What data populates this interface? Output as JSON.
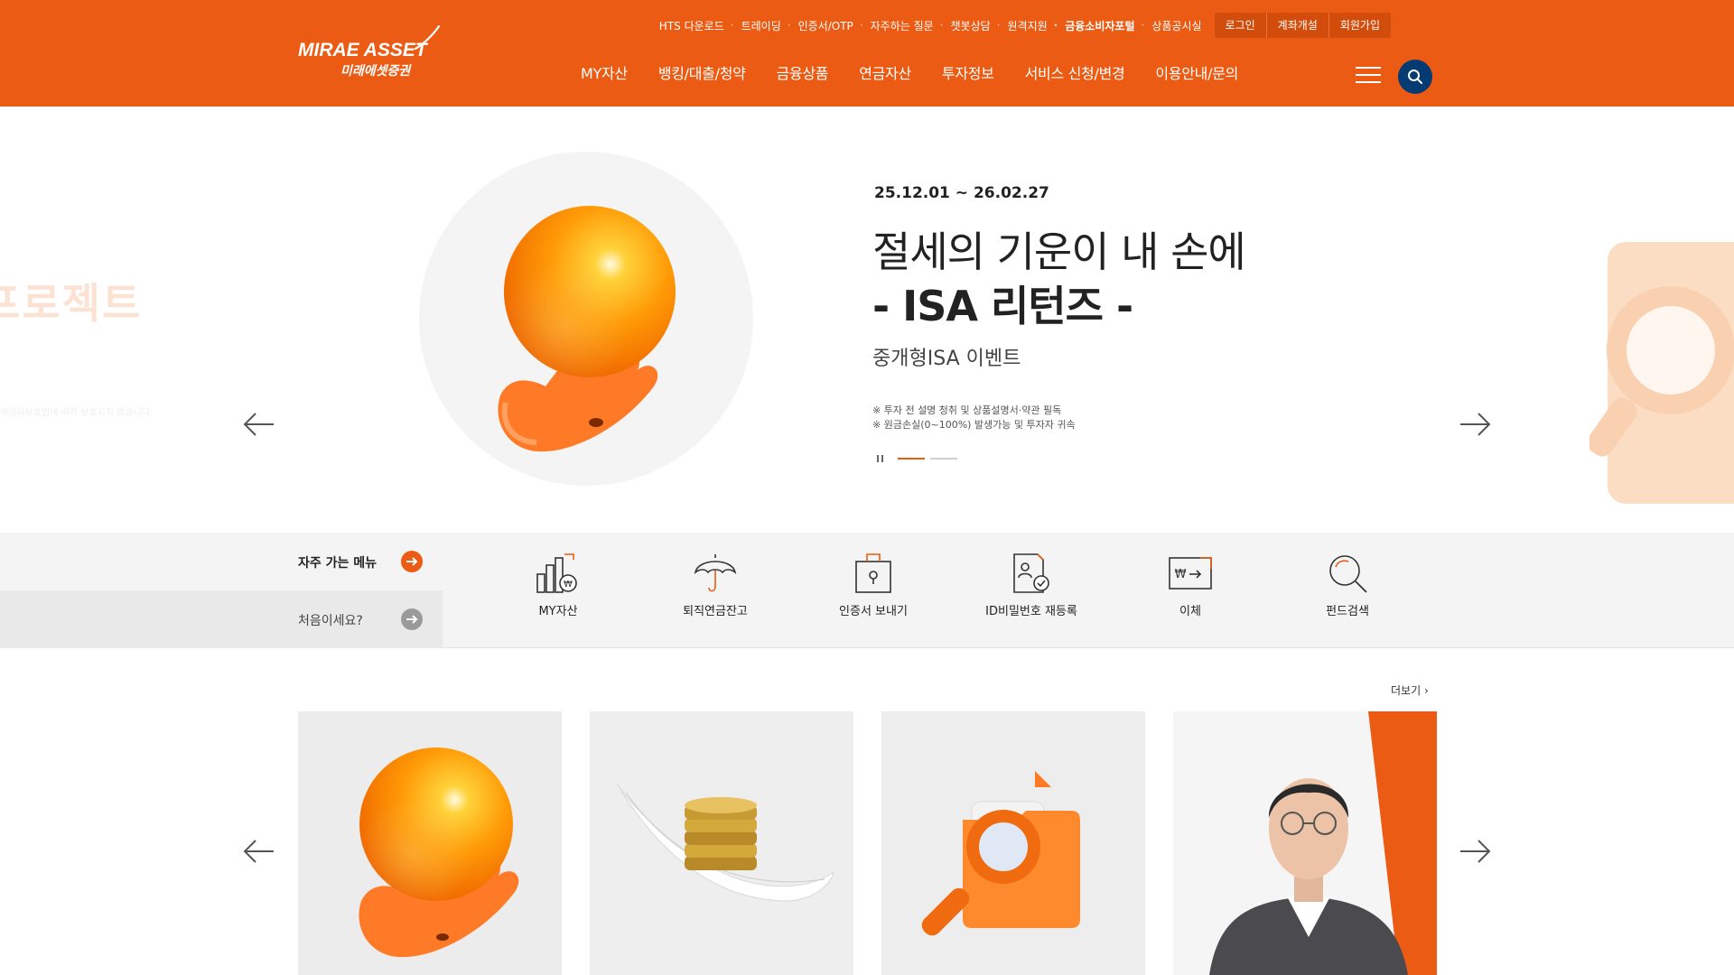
{
  "brand": {
    "logo_line1": "MIRAE ASSET",
    "logo_line2": "미래에셋증권",
    "primary_color": "#ec5b13",
    "accent_navy": "#043b72"
  },
  "header": {
    "util_links": [
      "HTS 다운로드",
      "트레이딩",
      "인증서/OTP",
      "자주하는 질문",
      "챗봇상담",
      "원격지원",
      "금융소비자포털",
      "상품공시실"
    ],
    "auth_links": [
      "로그인",
      "계좌개설",
      "회원가입"
    ],
    "main_nav": [
      "MY자산",
      "뱅킹/대출/청약",
      "금융상품",
      "연금자산",
      "투자정보",
      "서비스 신청/변경",
      "이용안내/문의"
    ],
    "menu_icon": "hamburger-icon",
    "search_icon": "search-icon"
  },
  "hero": {
    "date_range": "25.12.01 ~ 26.02.27",
    "title_line1": "절세의 기운이 내 손에",
    "title_line2": "- ISA 리턴즈 -",
    "subtitle": "중개형ISA 이벤트",
    "notes": [
      "※ 투자 전 설명 청취 및 상품설명서·약관 필독",
      "※ 원금손실(0~100%) 발생가능 및 투자자 귀속"
    ],
    "prev_slide_title": "프로젝트",
    "prev_slide_note": "예금자보호법에 따라 보호되지 않습니다.",
    "slide_count": 2,
    "active_slide": 1
  },
  "quick_menu": {
    "favorites_label": "자주 가는 메뉴",
    "first_time_label": "처음이세요?",
    "items": [
      {
        "label": "MY자산",
        "icon": "chart-won-icon"
      },
      {
        "label": "퇴직연금잔고",
        "icon": "umbrella-icon"
      },
      {
        "label": "인증서 보내기",
        "icon": "certificate-send-icon"
      },
      {
        "label": "ID비밀번호 재등록",
        "icon": "id-reset-icon"
      },
      {
        "label": "이체",
        "icon": "transfer-won-icon"
      },
      {
        "label": "펀드검색",
        "icon": "magnifier-icon"
      }
    ]
  },
  "cards": {
    "more_label": "더보기",
    "items": [
      {
        "image": "orb-hand-image"
      },
      {
        "image": "coins-feather-image"
      },
      {
        "image": "folder-magnifier-image"
      },
      {
        "image": "person-portrait-image"
      }
    ]
  }
}
